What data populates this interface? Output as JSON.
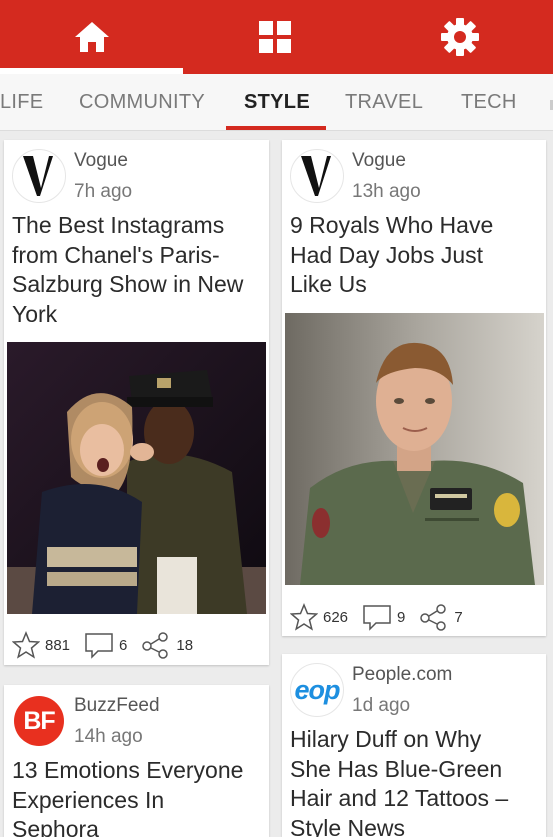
{
  "appbar": {
    "nav": [
      {
        "name": "home",
        "icon": "home-icon"
      },
      {
        "name": "grid",
        "icon": "grid-icon"
      },
      {
        "name": "settings",
        "icon": "gear-icon"
      }
    ],
    "accent_color": "#d42a1f"
  },
  "tabs": [
    {
      "label": "LIFE"
    },
    {
      "label": "COMMUNITY"
    },
    {
      "label": "STYLE",
      "active": true
    },
    {
      "label": "TRAVEL"
    },
    {
      "label": "TECH"
    }
  ],
  "cards": [
    {
      "source": "Vogue",
      "time": "7h ago",
      "title": [
        "The Best Instagrams",
        "from Chanel's Paris-",
        "Salzburg Show in New",
        "York"
      ],
      "logo": "vogue-logo",
      "photo": "photo-couple-military-jacket",
      "stars": "881",
      "comments": "6",
      "shares": "18"
    },
    {
      "source": "Vogue",
      "time": "13h ago",
      "title": [
        "9 Royals Who Have",
        "Had Day Jobs Just",
        "Like Us"
      ],
      "logo": "vogue-logo",
      "photo": "photo-man-flight-suit",
      "stars": "626",
      "comments": "9",
      "shares": "7"
    },
    {
      "source": "BuzzFeed",
      "time": "14h ago",
      "title": [
        "13 Emotions Everyone",
        "Experiences In",
        "Sephora"
      ],
      "logo": "buzzfeed-logo",
      "logo_text": "BF"
    },
    {
      "source": "People.com",
      "time": "1d ago",
      "title": [
        "Hilary Duff on Why",
        "She Has Blue-Green",
        "Hair and 12 Tattoos –",
        "Style News"
      ],
      "logo": "people-logo",
      "logo_text": "eop"
    }
  ]
}
